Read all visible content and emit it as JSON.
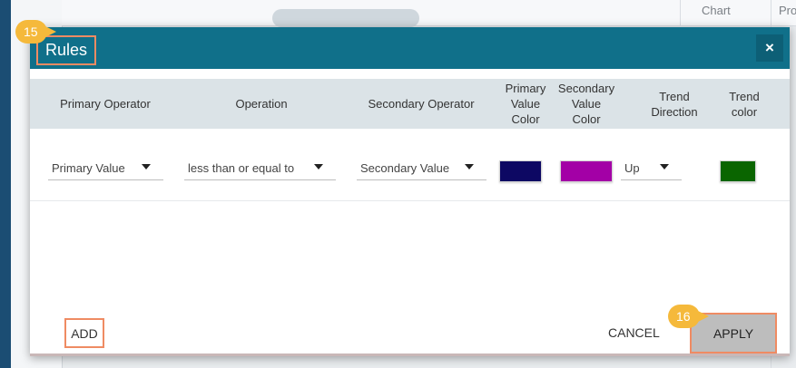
{
  "background": {
    "tab_chart": "Chart",
    "tab_partial": "Pro",
    "partial_char": "t"
  },
  "modal": {
    "title": "Rules",
    "close_icon": "×",
    "badge_title": "15",
    "badge_apply": "16",
    "columns": {
      "primary_operator": "Primary Operator",
      "operation": "Operation",
      "secondary_operator": "Secondary Operator",
      "primary_value_color": [
        "Primary",
        "Value",
        "Color"
      ],
      "secondary_value_color": [
        "Secondary",
        "Value",
        "Color"
      ],
      "trend_direction": [
        "Trend",
        "Direction"
      ],
      "trend_color": [
        "Trend",
        "color"
      ]
    },
    "rule": {
      "primary_operator": "Primary Value",
      "operation": "less than or equal to",
      "secondary_operator": "Secondary Value",
      "primary_value_color": "#0d0863",
      "secondary_value_color": "#a300a6",
      "trend_direction": "Up",
      "trend_color": "#0a6500"
    },
    "buttons": {
      "add": "ADD",
      "cancel": "CANCEL",
      "apply": "APPLY"
    }
  }
}
